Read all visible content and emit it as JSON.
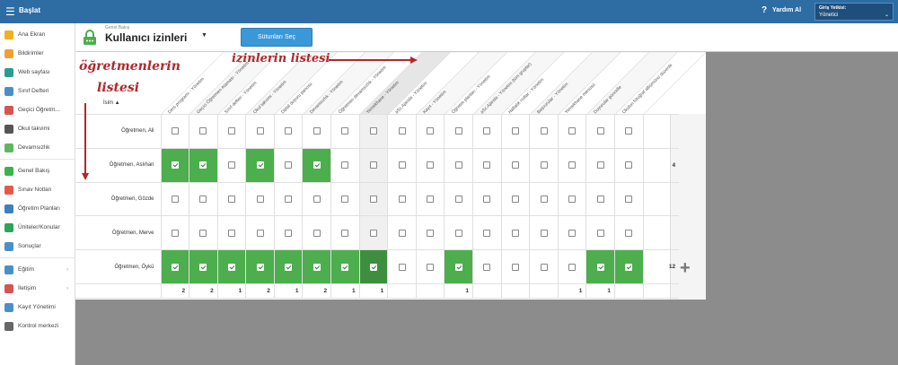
{
  "topbar": {
    "menu_icon": "hamburger-icon",
    "title": "Başlat",
    "help_icon": "question-icon",
    "help_label": "Yardım Al",
    "role_label": "Giriş Yetkisi:",
    "role_value": "Yönetici"
  },
  "sidebar": {
    "items": [
      {
        "label": "Ana Ekran",
        "icon": "star-icon",
        "color": "#f2b01e"
      },
      {
        "label": "Bildirimler",
        "icon": "envelope-icon",
        "color": "#f0a030"
      },
      {
        "label": "Web sayfası",
        "icon": "home-icon",
        "color": "#2a9d8f"
      },
      {
        "label": "Sınıf Defteri",
        "icon": "notebook-icon",
        "color": "#4a90c8"
      },
      {
        "label": "Geçici Öğretm...",
        "icon": "teacher-icon",
        "color": "#d9534f"
      },
      {
        "label": "Okul takvimi",
        "icon": "calendar-icon",
        "color": "#555555"
      },
      {
        "label": "Devamsızlık",
        "icon": "person-icon",
        "color": "#5cb85c"
      },
      {
        "label": "Genel Bakış",
        "icon": "check-circle-icon",
        "color": "#3cb34a"
      },
      {
        "label": "Sınav Notları",
        "icon": "grade-icon",
        "color": "#e8584a"
      },
      {
        "label": "Öğretim Planları",
        "icon": "book-icon",
        "color": "#3d7fbf"
      },
      {
        "label": "Üniteler/Konular",
        "icon": "shield-icon",
        "color": "#2aa55a"
      },
      {
        "label": "Sonuçlar",
        "icon": "bar-chart-icon",
        "color": "#4a90c8"
      },
      {
        "label": "Eğitim",
        "icon": "monitor-icon",
        "color": "#4a90c8"
      },
      {
        "label": "İletişim",
        "icon": "chat-icon",
        "color": "#d9534f"
      },
      {
        "label": "Kayıt Yönetimi",
        "icon": "pen-icon",
        "color": "#4a90c8"
      },
      {
        "label": "Kontrol merkezi",
        "icon": "gear-icon",
        "color": "#666666"
      }
    ]
  },
  "header": {
    "breadcrumb": "Genel Bakış",
    "title": "Kullanıcı izinleri",
    "columns_button": "Sütunları Seç"
  },
  "annotations": {
    "permissions_list": "izinlerin listesi",
    "teachers_list_line1": "öğretmenlerin",
    "teachers_list_line2": "listesi"
  },
  "table": {
    "name_header": "İsim ▲",
    "columns": [
      "Ders programı - Yönetim",
      "Geçici Öğretmen Ataması - Yönetim",
      "Sınıf defteri - Yönetim",
      "Okul takvimi - Yönetim",
      "Dijital duyuru panosu",
      "Devamsızlık - Yönetim",
      "Öğretmen devamsızlık - Yönetim",
      "Yemekhane - Yönetim",
      "aSc Ajanda - Yönetim",
      "Kayıt - Yönetim",
      "Öğretim planları - Yönetim",
      "aSc Ajanda - Yönetim (tüm gruplar)",
      "Haftalık notlar - Yönetim",
      "Başvurular - Yönetim",
      "Yemekhane menüsü",
      "Duyurular güncelle",
      "Okulun fotoğraf albümünü düzenle"
    ],
    "rows": [
      {
        "name": "Öğretmen, Ali",
        "checks": [
          0,
          0,
          0,
          0,
          0,
          0,
          0,
          0,
          0,
          0,
          0,
          0,
          0,
          0,
          0,
          0,
          0
        ],
        "total": ""
      },
      {
        "name": "Öğretmen, Aslıhan",
        "checks": [
          1,
          1,
          0,
          1,
          0,
          1,
          0,
          0,
          0,
          0,
          0,
          0,
          0,
          0,
          0,
          0,
          0
        ],
        "total": "4"
      },
      {
        "name": "Öğretmen, Gözde",
        "checks": [
          0,
          0,
          0,
          0,
          0,
          0,
          0,
          0,
          0,
          0,
          0,
          0,
          0,
          0,
          0,
          0,
          0
        ],
        "total": ""
      },
      {
        "name": "Öğretmen, Merve",
        "checks": [
          0,
          0,
          0,
          0,
          0,
          0,
          0,
          0,
          0,
          0,
          0,
          0,
          0,
          0,
          0,
          0,
          0
        ],
        "total": ""
      },
      {
        "name": "Öğretmen, Öykü",
        "checks": [
          1,
          1,
          1,
          1,
          1,
          1,
          1,
          1,
          0,
          0,
          1,
          0,
          0,
          0,
          0,
          1,
          1
        ],
        "total": "12"
      }
    ],
    "column_totals": [
      "2",
      "2",
      "1",
      "2",
      "1",
      "2",
      "1",
      "1",
      "",
      "",
      "1",
      "",
      "",
      "",
      "1",
      "1",
      ""
    ],
    "add_icon": "plus-icon"
  }
}
